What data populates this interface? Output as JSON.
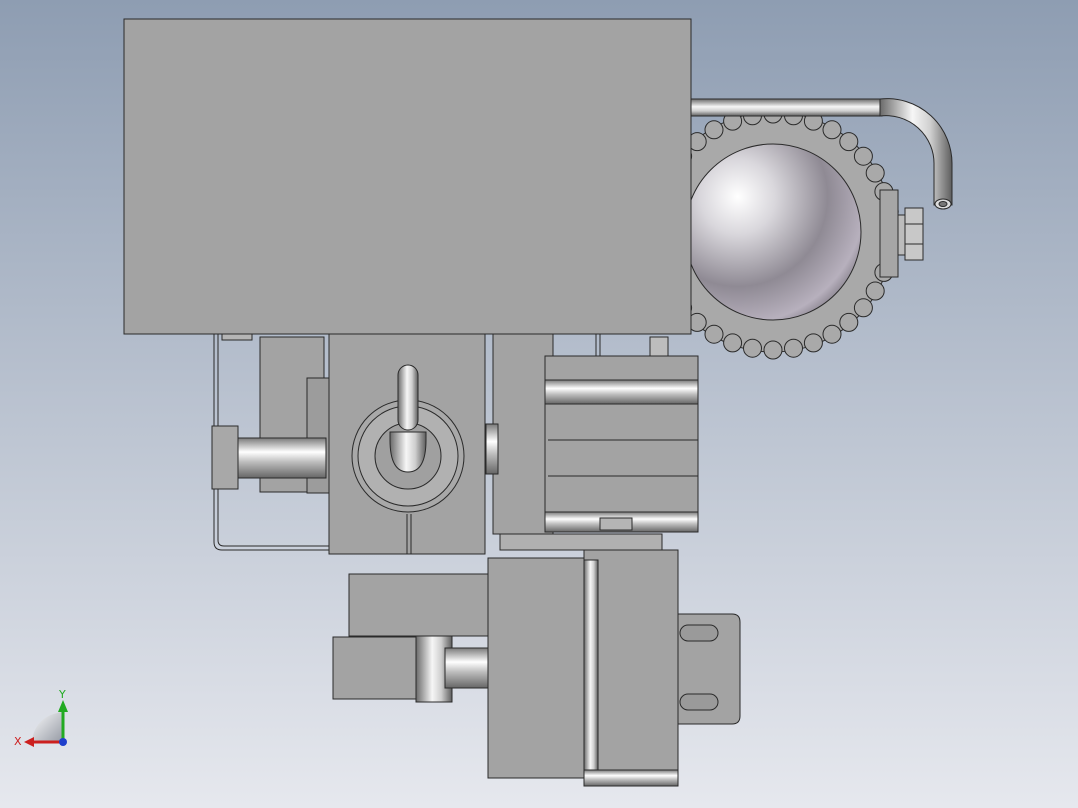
{
  "viewport": {
    "background_top": "#8e9db2",
    "background_bottom": "#e6e8ee"
  },
  "triad": {
    "x_label": "X",
    "y_label": "Y",
    "x_color": "#cc1f1f",
    "y_color": "#22aa22",
    "z_color": "#1f3fcc"
  },
  "model": {
    "body_color": "#a3a3a3",
    "edge_color": "#2a2a2a",
    "chrome_light": "#f4f4f4",
    "chrome_dark": "#6a6a6a"
  }
}
